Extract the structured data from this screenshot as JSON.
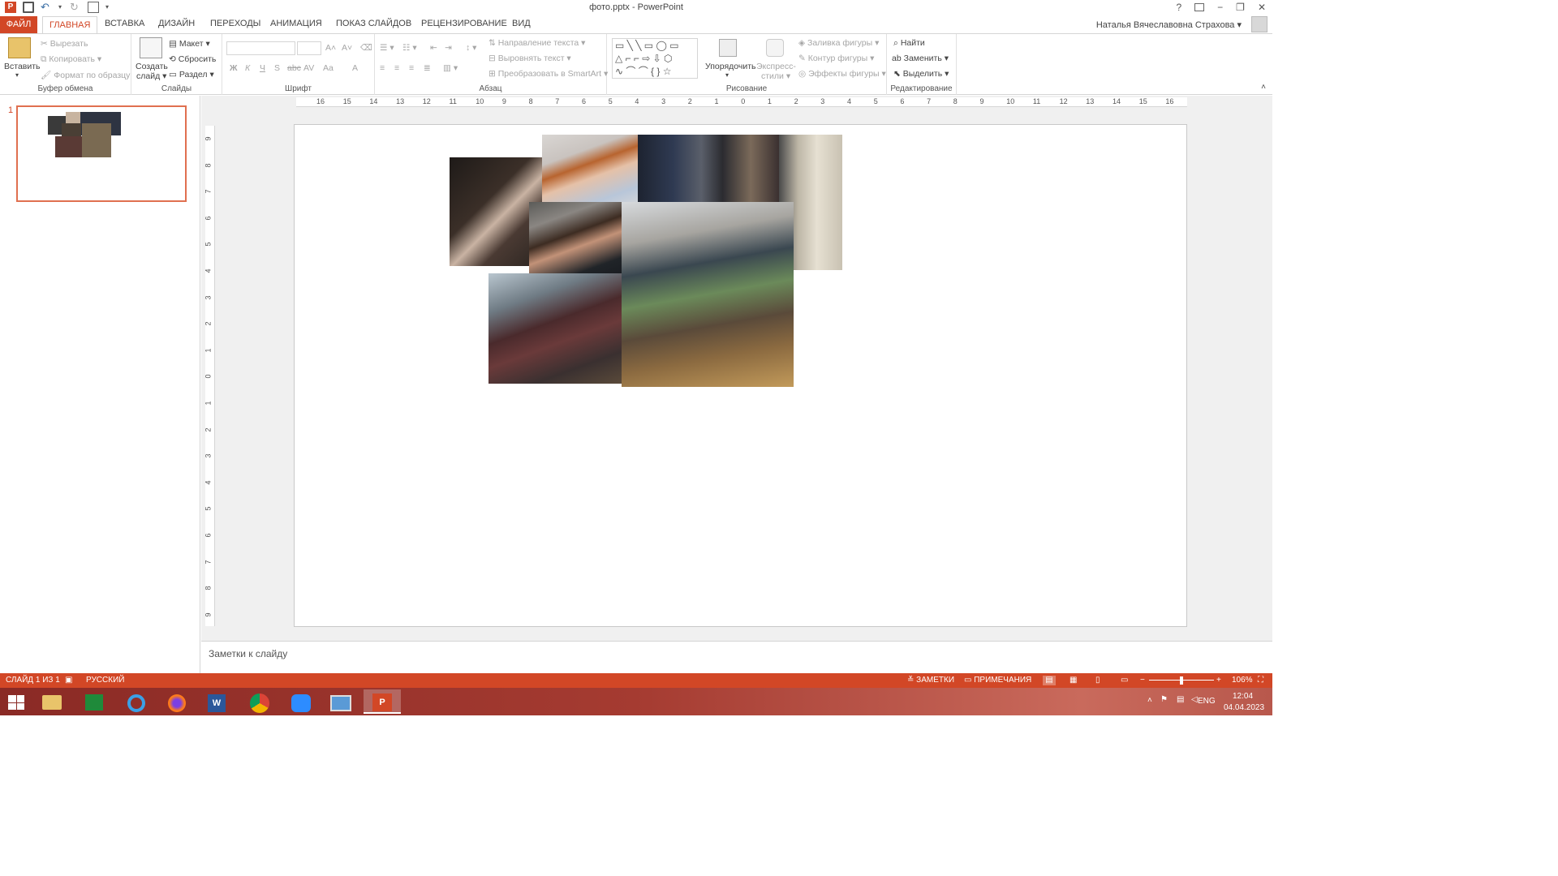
{
  "window": {
    "title": "фото.pptx - PowerPoint",
    "help": "?",
    "controls": [
      "−",
      "❐",
      "✕"
    ]
  },
  "tabs": {
    "file": "ФАЙЛ",
    "items": [
      "ГЛАВНАЯ",
      "ВСТАВКА",
      "ДИЗАЙН",
      "ПЕРЕХОДЫ",
      "АНИМАЦИЯ",
      "ПОКАЗ СЛАЙДОВ",
      "РЕЦЕНЗИРОВАНИЕ",
      "ВИД"
    ],
    "active": "ГЛАВНАЯ"
  },
  "user": {
    "name": "Наталья Вячеславовна Страхова"
  },
  "ribbon": {
    "clipboard": {
      "label": "Буфер обмена",
      "paste": "Вставить",
      "cut": "Вырезать",
      "copy": "Копировать",
      "format_painter": "Формат по образцу"
    },
    "slides": {
      "label": "Слайды",
      "new_slide_1": "Создать",
      "new_slide_2": "слайд",
      "layout": "Макет",
      "reset": "Сбросить",
      "section": "Раздел"
    },
    "font": {
      "label": "Шрифт",
      "bold": "Ж",
      "italic": "К",
      "underline": "Ч",
      "strike": "S",
      "strike2": "abc",
      "spacing": "AV",
      "case": "Aa",
      "color": "A"
    },
    "paragraph": {
      "label": "Абзац",
      "text_direction": "Направление текста",
      "align_text": "Выровнять текст",
      "smartart": "Преобразовать в SmartArt"
    },
    "drawing": {
      "label": "Рисование",
      "arrange": "Упорядочить",
      "quick_styles_1": "Экспресс-",
      "quick_styles_2": "стили",
      "fill": "Заливка фигуры",
      "outline": "Контур фигуры",
      "effects": "Эффекты фигуры"
    },
    "editing": {
      "label": "Редактирование",
      "find": "Найти",
      "replace": "Заменить",
      "select": "Выделить"
    }
  },
  "rulers": {
    "horizontal": [
      "16",
      "15",
      "14",
      "13",
      "12",
      "11",
      "10",
      "9",
      "8",
      "7",
      "6",
      "5",
      "4",
      "3",
      "2",
      "1",
      "0",
      "1",
      "2",
      "3",
      "4",
      "5",
      "6",
      "7",
      "8",
      "9",
      "10",
      "11",
      "12",
      "13",
      "14",
      "15",
      "16"
    ],
    "vertical": [
      "9",
      "8",
      "7",
      "6",
      "5",
      "4",
      "3",
      "2",
      "1",
      "0",
      "1",
      "2",
      "3",
      "4",
      "5",
      "6",
      "7",
      "8",
      "9"
    ]
  },
  "panel": {
    "slide_number": "1"
  },
  "notes": {
    "placeholder": "Заметки к слайду"
  },
  "status": {
    "slide": "СЛАЙД 1 ИЗ 1",
    "language": "РУССКИЙ",
    "notes": "ЗАМЕТКИ",
    "comments": "ПРИМЕЧАНИЯ",
    "zoom": "106%",
    "zoom_minus": "−",
    "zoom_plus": "+"
  },
  "taskbar": {
    "lang": "ENG",
    "time": "12:04",
    "date": "04.04.2023"
  },
  "colors": {
    "accent": "#d24726",
    "thumb_border": "#e07050"
  }
}
